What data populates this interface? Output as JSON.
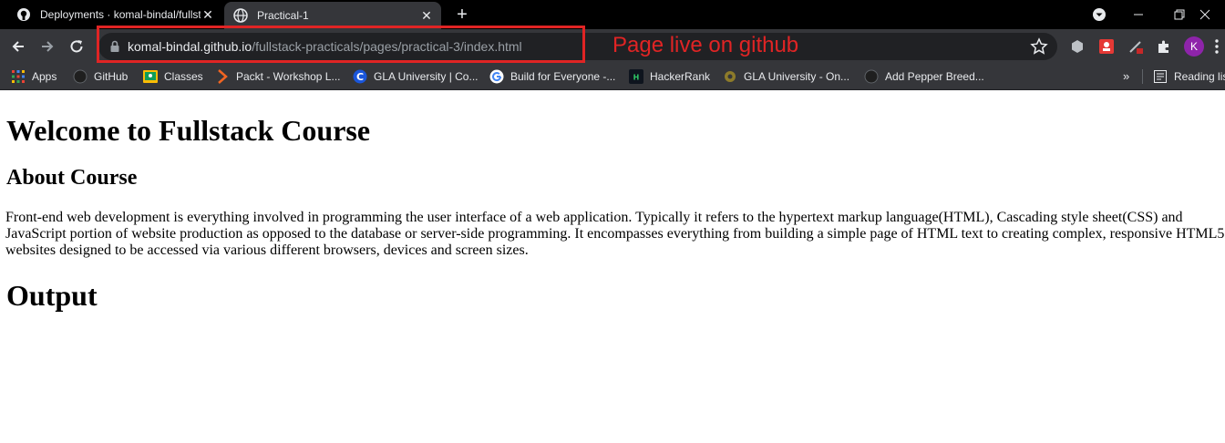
{
  "tabs": [
    {
      "title": "Deployments · komal-bindal/fullstack-practicals",
      "favicon": "github-icon",
      "active": false
    },
    {
      "title": "Practical-1",
      "favicon": "globe-icon",
      "active": true
    }
  ],
  "address_bar": {
    "host": "komal-bindal.github.io",
    "path": "/fullstack-practicals/pages/practical-3/index.html"
  },
  "annotation": {
    "text": "Page live on github",
    "color": "#e02424"
  },
  "profile": {
    "initial": "K"
  },
  "bookmarks": [
    {
      "label": "Apps",
      "icon": "apps-grid-icon"
    },
    {
      "label": "GitHub",
      "icon": "github-icon"
    },
    {
      "label": "Classes",
      "icon": "classroom-icon"
    },
    {
      "label": "Packt - Workshop L...",
      "icon": "packt-icon"
    },
    {
      "label": "GLA University | Co...",
      "icon": "c-logo-icon"
    },
    {
      "label": "Build for Everyone -...",
      "icon": "google-icon"
    },
    {
      "label": "HackerRank",
      "icon": "hackerrank-icon"
    },
    {
      "label": "GLA University - On...",
      "icon": "gla-logo-icon"
    },
    {
      "label": "Add Pepper Breed...",
      "icon": "github-icon"
    }
  ],
  "bookmarks_more": "»",
  "reading_list": "Reading list",
  "content": {
    "heading": "Welcome to Fullstack Course",
    "subheading": "About Course",
    "paragraph": "Front-end web development is everything involved in programming the user interface of a web application. Typically it refers to the hypertext markup language(HTML), Cascading style sheet(CSS) and JavaScript portion of website production as opposed to the database or server-side programming. It encompasses everything from building a simple page of HTML text to creating complex, responsive HTML5 websites designed to be accessed via various different browsers, devices and screen sizes.",
    "output_heading": "Output"
  }
}
